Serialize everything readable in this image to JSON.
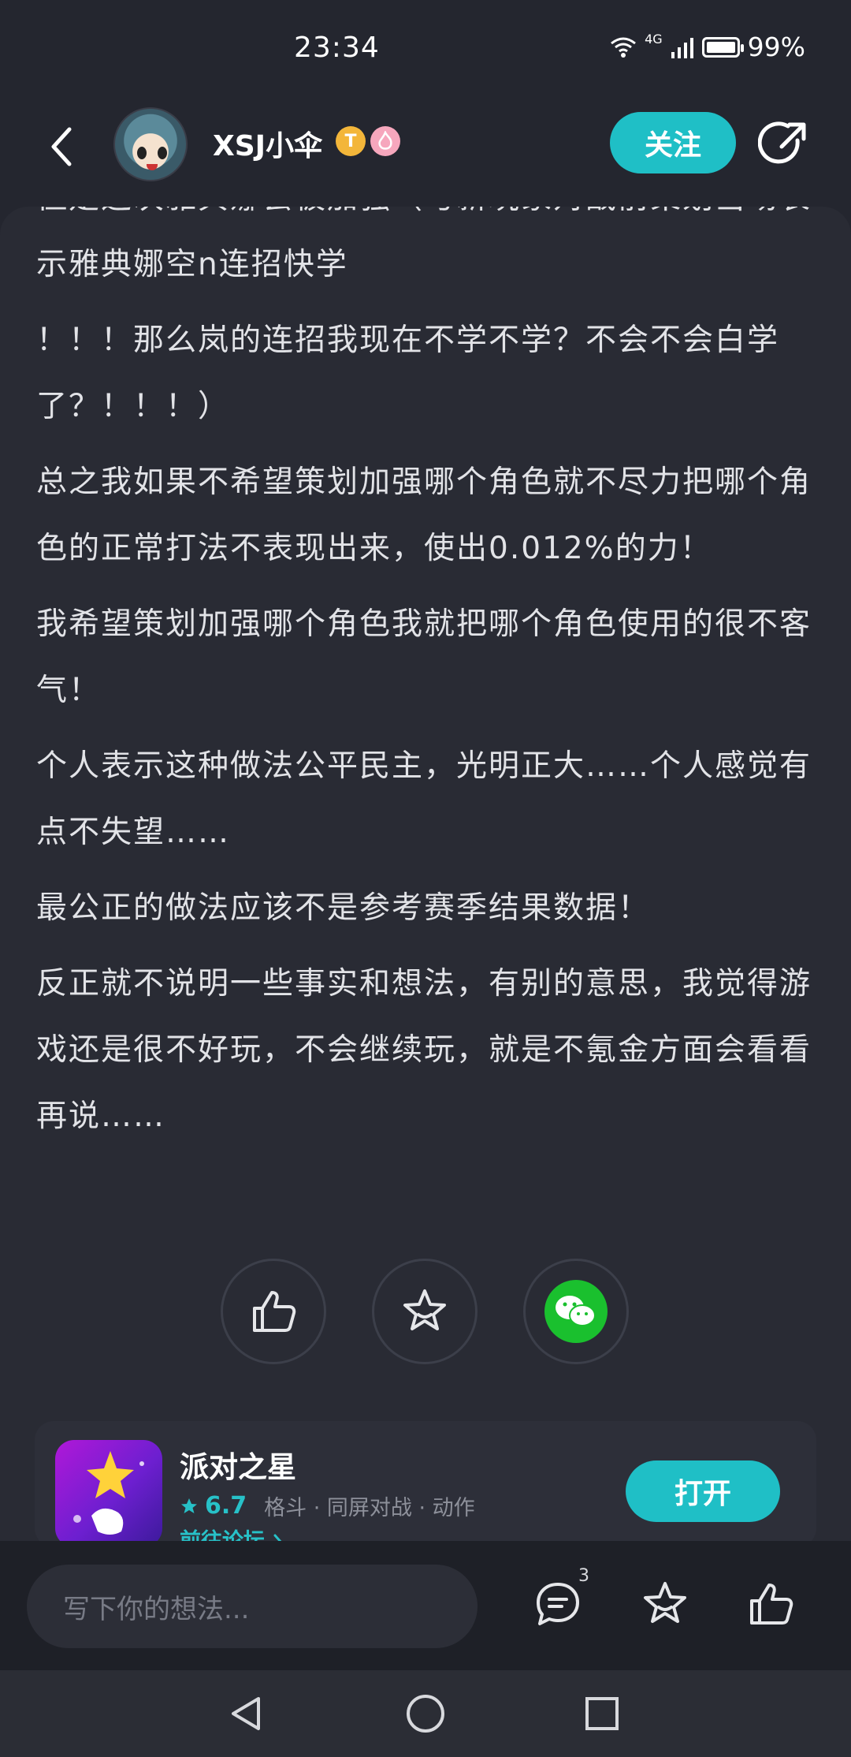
{
  "status_bar": {
    "time": "23:34",
    "network": "4G",
    "battery": "99%",
    "battery_level": 0.99
  },
  "header": {
    "back_icon": "chevron-left-icon",
    "username": "XSJ小伞",
    "badge_t": "T",
    "follow_label": "关注",
    "share_icon": "share-icon"
  },
  "article": {
    "paragraphs": [
      "但是这次雅典娜会被加强（与新玩家对战前策划当场表示雅典娜空n连招快学",
      "！！！那么岚的连招我现在不学不学？不会不会白学了？！！！）",
      "总之我如果不希望策划加强哪个角色就不尽力把哪个角色的正常打法不表现出来，使出0.012%的力！",
      "我希望策划加强哪个角色我就把哪个角色使用的很不客气！",
      "个人表示这种做法公平民主，光明正大……个人感觉有点不失望……",
      "最公正的做法应该不是参考赛季结果数据！",
      "反正就不说明一些事实和想法，有别的意思，我觉得游戏还是很不好玩，不会继续玩，就是不氪金方面会看看再说……"
    ]
  },
  "actions": {
    "like_icon": "thumbs-up-icon",
    "favorite_icon": "star-icon",
    "wechat_icon": "wechat-icon"
  },
  "app_card": {
    "name": "派对之星",
    "rating": "6.7",
    "tags": "格斗 · 同屏对战 · 动作",
    "forum_link": "前往论坛 ",
    "open_label": "打开"
  },
  "bottom_bar": {
    "input_placeholder": "写下你的想法...",
    "comment_count": "3"
  },
  "colors": {
    "accent": "#1fbfc6",
    "background": "#24262f",
    "card": "#292b34"
  }
}
